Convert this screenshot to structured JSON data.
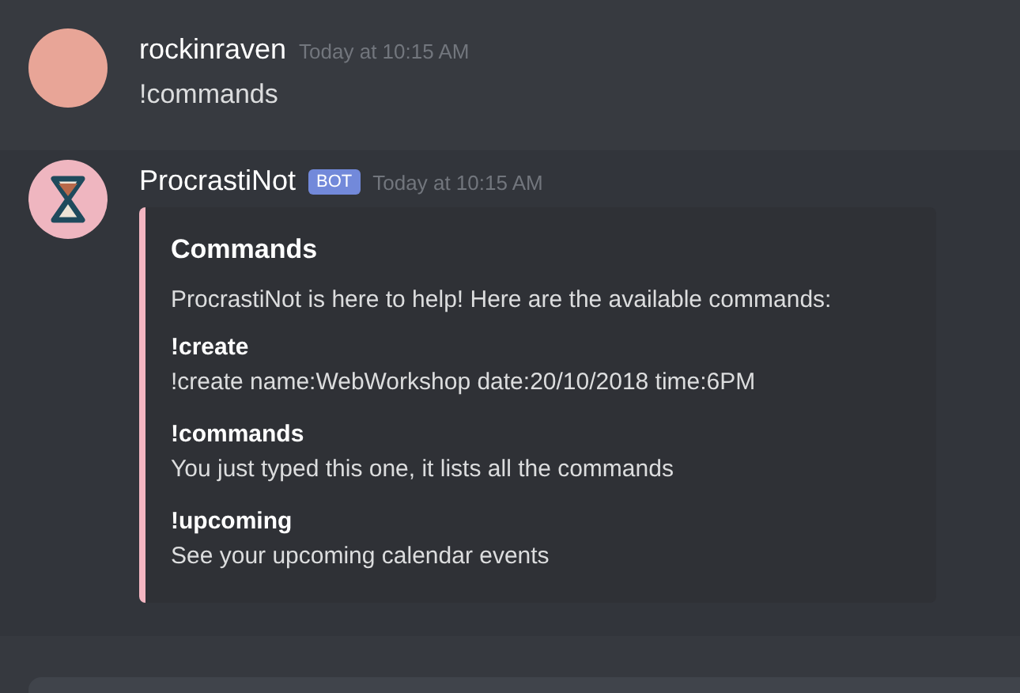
{
  "messages": [
    {
      "author": "rockinraven",
      "bot": false,
      "timestamp": "Today at 10:15 AM",
      "highlighted": false,
      "text": "!commands"
    },
    {
      "author": "ProcrastiNot",
      "bot": true,
      "badge": "BOT",
      "timestamp": "Today at 10:15 AM",
      "highlighted": true,
      "embed": {
        "color": "#f4b6c2",
        "title": "Commands",
        "description": "ProcrastiNot is here to help! Here are the available commands:",
        "fields": [
          {
            "name": "!create",
            "value": "!create name:WebWorkshop date:20/10/2018 time:6PM"
          },
          {
            "name": "!commands",
            "value": "You just typed this one, it lists all the commands"
          },
          {
            "name": "!upcoming",
            "value": "See your upcoming calendar events"
          }
        ]
      }
    }
  ]
}
